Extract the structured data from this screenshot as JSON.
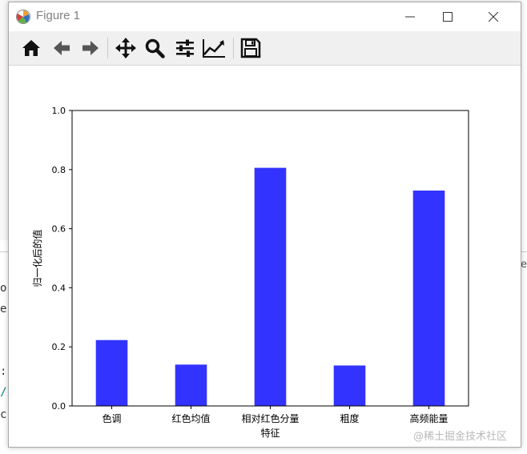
{
  "window": {
    "title": "Figure 1",
    "icons": {
      "app": "matplotlib-icon",
      "minimize": "minimize-icon",
      "maximize": "maximize-icon",
      "close": "close-icon"
    }
  },
  "toolbar": {
    "tools": [
      {
        "name": "home",
        "icon": "home-icon"
      },
      {
        "name": "back",
        "icon": "arrow-left-icon"
      },
      {
        "name": "forward",
        "icon": "arrow-right-icon"
      },
      {
        "name": "pan",
        "icon": "move-icon"
      },
      {
        "name": "zoom",
        "icon": "magnifier-icon"
      },
      {
        "name": "subplots",
        "icon": "sliders-icon"
      },
      {
        "name": "edit-axis",
        "icon": "line-chart-icon"
      },
      {
        "name": "save",
        "icon": "floppy-disk-icon"
      }
    ]
  },
  "chart_data": {
    "type": "bar",
    "categories": [
      "色调",
      "红色均值",
      "相对红色分量",
      "粗度",
      "高频能量"
    ],
    "values": [
      0.223,
      0.14,
      0.806,
      0.137,
      0.729
    ],
    "title": "",
    "xlabel": "特征",
    "ylabel": "归一化后的值",
    "ylim": [
      0,
      1.0
    ],
    "yticks": [
      "0.0",
      "0.2",
      "0.4",
      "0.6",
      "0.8",
      "1.0"
    ],
    "bar_color": "#3333ff",
    "grid": false
  },
  "background": {
    "chars": [
      ":",
      "/",
      "c",
      "o",
      "e"
    ],
    "right_char": "e",
    "teal": "#1f8f8f"
  },
  "watermark": "@稀土掘金技术社区"
}
